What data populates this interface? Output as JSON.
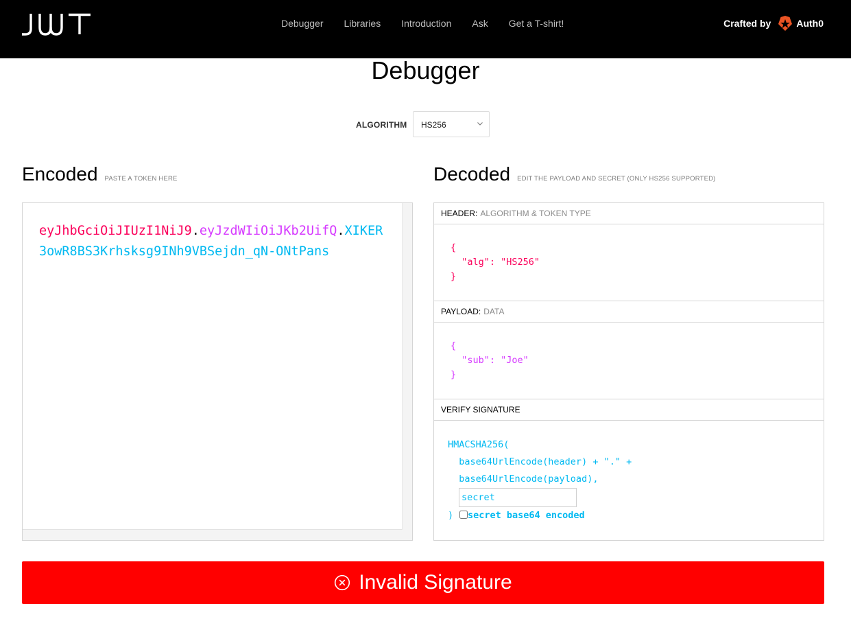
{
  "nav": {
    "logo_text": "JWT",
    "links": [
      "Debugger",
      "Libraries",
      "Introduction",
      "Ask",
      "Get a T-shirt!"
    ],
    "crafted_by": "Crafted by",
    "brand": "Auth0"
  },
  "page": {
    "title": "Debugger",
    "algorithm_label": "ALGORITHM",
    "algorithm_value": "HS256"
  },
  "encoded": {
    "heading": "Encoded",
    "hint": "PASTE A TOKEN HERE",
    "token_header": "eyJhbGciOiJIUzI1NiJ9",
    "token_payload": "eyJzdWIiOiJKb2UifQ",
    "token_signature": "XIKER3owR8BS3Krhsksg9INh9VBSejdn_qN-ONtPans",
    "dot": "."
  },
  "decoded": {
    "heading": "Decoded",
    "hint": "EDIT THE PAYLOAD AND SECRET (ONLY HS256 SUPPORTED)",
    "header_title": "HEADER:",
    "header_sub": "ALGORITHM & TOKEN TYPE",
    "header_json": "{\n  \"alg\": \"HS256\"\n}",
    "payload_title": "PAYLOAD:",
    "payload_sub": "DATA",
    "payload_json": "{\n  \"sub\": \"Joe\"\n}",
    "verify_title": "VERIFY SIGNATURE",
    "verify_code": "HMACSHA256(\n  base64UrlEncode(header) + \".\" +\n  base64UrlEncode(payload),",
    "secret_placeholder": "secret",
    "close_paren": ")",
    "base64_label": "secret base64 encoded",
    "base64_checked": false
  },
  "status": {
    "text": "Invalid Signature",
    "icon": "x-circle-icon",
    "color": "#ff0000"
  },
  "colors": {
    "header": "#fb015b",
    "payload": "#d63aff",
    "signature": "#00b9f1",
    "brand_orange": "#eb5424"
  }
}
